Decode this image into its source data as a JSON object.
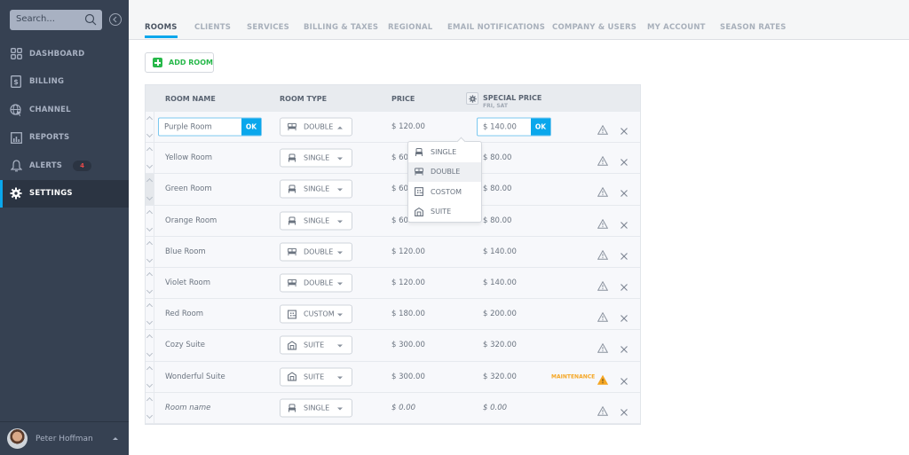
{
  "sidebar": {
    "search_placeholder": "Search...",
    "items": [
      {
        "label": "DASHBOARD",
        "icon": "dashboard-icon"
      },
      {
        "label": "BILLING",
        "icon": "billing-icon"
      },
      {
        "label": "CHANNEL",
        "icon": "channel-icon"
      },
      {
        "label": "REPORTS",
        "icon": "reports-icon"
      },
      {
        "label": "ALERTS",
        "icon": "bell-icon",
        "badge": "4"
      },
      {
        "label": "SETTINGS",
        "icon": "gear-icon",
        "active": true
      }
    ],
    "user": {
      "name": "Peter Hoffman"
    }
  },
  "tabs": [
    {
      "label": "ROOMS",
      "active": true
    },
    {
      "label": "CLIENTS"
    },
    {
      "label": "SERVICES"
    },
    {
      "label": "BILLING & TAXES"
    },
    {
      "label": "REGIONAL"
    },
    {
      "label": "EMAIL NOTIFICATIONS"
    },
    {
      "label": "COMPANY & USERS"
    },
    {
      "label": "MY ACCOUNT"
    },
    {
      "label": "SEASON RATES"
    }
  ],
  "toolbar": {
    "add_room_label": "ADD ROOM"
  },
  "table": {
    "headers": {
      "room_name": "ROOM NAME",
      "room_type": "ROOM TYPE",
      "price": "PRICE",
      "special_price": "SPECIAL PRICE",
      "special_price_sub": "FRI, SAT"
    },
    "rows": [
      {
        "name": "Purple Room",
        "type": "DOUBLE",
        "price": "$ 120.00",
        "special_price": "$ 140.00",
        "editing": true,
        "ok_label": "OK"
      },
      {
        "name": "Yellow Room",
        "type": "SINGLE",
        "price": "$ 60.00",
        "special_price": "$ 80.00"
      },
      {
        "name": "Green Room",
        "type": "SINGLE",
        "price": "$ 60.00",
        "special_price": "$ 80.00"
      },
      {
        "name": "Orange Room",
        "type": "SINGLE",
        "price": "$ 60.00",
        "special_price": "$ 80.00"
      },
      {
        "name": "Blue Room",
        "type": "DOUBLE",
        "price": "$ 120.00",
        "special_price": "$ 140.00"
      },
      {
        "name": "Violet Room",
        "type": "DOUBLE",
        "price": "$ 120.00",
        "special_price": "$ 140.00"
      },
      {
        "name": "Red Room",
        "type": "CUSTOM",
        "price": "$ 180.00",
        "special_price": "$ 200.00"
      },
      {
        "name": "Cozy  Suite",
        "type": "SUITE",
        "price": "$ 300.00",
        "special_price": "$ 320.00"
      },
      {
        "name": "Wonderful Suite",
        "type": "SUITE",
        "price": "$ 300.00",
        "special_price": "$ 320.00",
        "status": "MAINTENANCE"
      },
      {
        "name": "Room name",
        "type": "SINGLE",
        "price": "$ 0.00",
        "special_price": "$ 0.00",
        "placeholder": true
      }
    ],
    "type_dropdown": {
      "options": [
        "SINGLE",
        "DOUBLE",
        "COSTOM",
        "SUITE"
      ],
      "selected": "DOUBLE"
    }
  },
  "colors": {
    "accent": "#0aa7ec",
    "success": "#27b84a",
    "warning": "#f5a623",
    "alert_badge": "#e54a4a",
    "sidebar_bg": "#364152"
  }
}
